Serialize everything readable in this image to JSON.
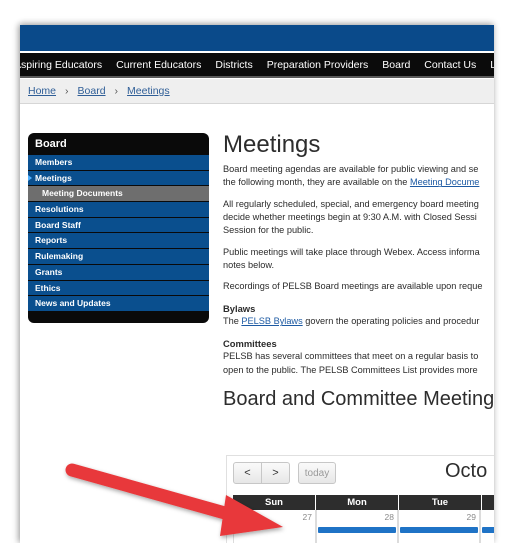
{
  "nav": {
    "items": [
      "Aspiring Educators",
      "Current Educators",
      "Districts",
      "Preparation Providers",
      "Board",
      "Contact Us",
      "Licensing"
    ]
  },
  "breadcrumbs": [
    "Home",
    "Board",
    "Meetings"
  ],
  "breadcrumb_sep": "›",
  "sidebar": {
    "title": "Board",
    "items": [
      {
        "label": "Members"
      },
      {
        "label": "Meetings",
        "active": true
      },
      {
        "label": "Meeting Documents",
        "sub": true
      },
      {
        "label": "Resolutions"
      },
      {
        "label": "Board Staff"
      },
      {
        "label": "Reports"
      },
      {
        "label": "Rulemaking"
      },
      {
        "label": "Grants"
      },
      {
        "label": "Ethics"
      },
      {
        "label": "News and Updates"
      }
    ]
  },
  "main": {
    "title": "Meetings",
    "p1_line1": "Board meeting agendas are available for public viewing and se",
    "p1_line2_pre": "the following month, they are available on the ",
    "p1_line2_link": "Meeting Docume",
    "p2_line1": "All regularly scheduled, special, and emergency board meeting",
    "p2_line2": "decide whether meetings begin at 9:30 A.M. with Closed Sessi",
    "p2_line3": "Session for the public.",
    "p3_line1": "Public meetings will take place through Webex. Access informa",
    "p3_line2": "notes below.",
    "p4": "Recordings of PELSB Board meetings are available upon reque",
    "bylaws_heading": "Bylaws",
    "bylaws_pre": "The ",
    "bylaws_link": "PELSB Bylaws",
    "bylaws_post": " govern the operating policies and procedur",
    "committees_heading": "Committees",
    "committees_line1": "PELSB has several committees that meet on a regular basis to",
    "committees_line2": "open to the public. The PELSB Committees List provides more",
    "calendar_heading": "Board and Committee Meetings :"
  },
  "calendar": {
    "prev": "<",
    "next": ">",
    "today": "today",
    "month_title": "Octo",
    "days": [
      "Sun",
      "Mon",
      "Tue",
      ""
    ],
    "dates": [
      "27",
      "28",
      "29",
      ""
    ]
  },
  "colors": {
    "topbar": "#0a4a8a",
    "sidebar_item": "#0a4f8e",
    "accent_arrow": "#e8383a"
  }
}
